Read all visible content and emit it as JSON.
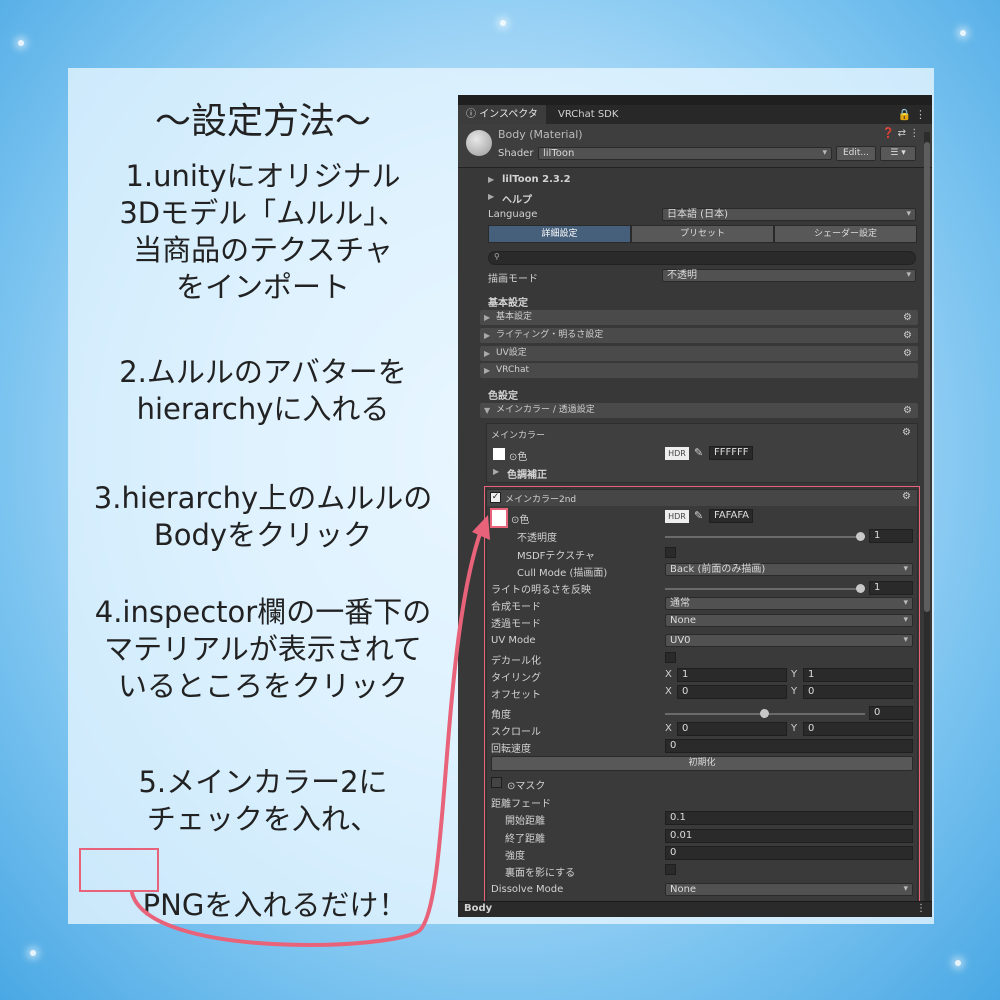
{
  "colors": {
    "accent": "#e8637a",
    "panel_bg": "#383838",
    "card_bg": "#e8f6ff"
  },
  "instructions": {
    "heading": "〜設定方法〜",
    "steps": [
      "1.unityにオリジナル\n3Dモデル「ムルル」、\n当商品のテクスチャ\nをインポート",
      "2.ムルルのアバターを\nhierarchyに入れる",
      "3.hierarchy上のムルルの\nBodyをクリック",
      "4.inspector欄の一番下の\nマテリアルが表示されて\nいるところをクリック",
      "5.メインカラー2に\nチェックを入れ、"
    ],
    "last_line_highlight": "PNG",
    "last_line_rest": "を入れるだけ！"
  },
  "inspector": {
    "tab_inspector": "インスペクター",
    "tab_vrchat": "VRChat SDK",
    "material_name": "Body (Material)",
    "shader_label": "Shader",
    "shader_value": "lilToon",
    "edit_button": "Edit...",
    "liltoon_version": "lilToon 2.3.2",
    "help_label": "ヘルプ",
    "language_label": "Language",
    "language_value": "日本語 (日本)",
    "tabs": [
      "詳細設定",
      "プリセット",
      "シェーダー設定"
    ],
    "render_mode_label": "描画モード",
    "render_mode_value": "不透明",
    "basic_settings_title": "基本設定",
    "basic_sections": [
      "基本設定",
      "ライティング・明るさ設定",
      "UV設定",
      "VRChat"
    ],
    "color_settings_title": "色設定",
    "main_color_section": "メインカラー / 透過設定",
    "main_color_box_title": "メインカラー",
    "color_label": "⊙色",
    "hdr_label": "HDR",
    "main_color_hex": "FFFFFF",
    "color_correction": "色調補正",
    "main_color2_title": "メインカラー2nd",
    "main_color2_hex": "FAFAFA",
    "rows": {
      "opacity": "不透明度",
      "opacity_value": "1",
      "msdf": "MSDFテクスチャ",
      "cull_mode": "Cull Mode (描画面)",
      "cull_mode_value": "Back (前面のみ描画)",
      "light_reflect": "ライトの明るさを反映",
      "light_value": "1",
      "blend_mode": "合成モード",
      "blend_value": "通常",
      "transparent_mode": "透過モード",
      "transparent_value": "None",
      "uv_mode": "UV Mode",
      "uv_value": "UV0",
      "decal": "デカール化",
      "tiling": "タイリング",
      "tiling_x": "1",
      "tiling_y": "1",
      "offset": "オフセット",
      "offset_x": "0",
      "offset_y": "0",
      "angle": "角度",
      "angle_value": "0",
      "scroll": "スクロール",
      "scroll_x": "0",
      "scroll_y": "0",
      "rotate_speed": "回転速度",
      "rotate_value": "0",
      "init_button": "初期化",
      "mask": "⊙マスク",
      "distance_fade": "距離フェード",
      "fade_start": "開始距離",
      "fade_start_value": "0.1",
      "fade_end": "終了距離",
      "fade_end_value": "0.01",
      "strength": "強度",
      "strength_value": "0",
      "backface_shadow": "裏面を影にする",
      "dissolve_mode": "Dissolve Mode",
      "dissolve_value": "None"
    },
    "axis_x": "X",
    "axis_y": "Y",
    "footer_label": "Body"
  }
}
